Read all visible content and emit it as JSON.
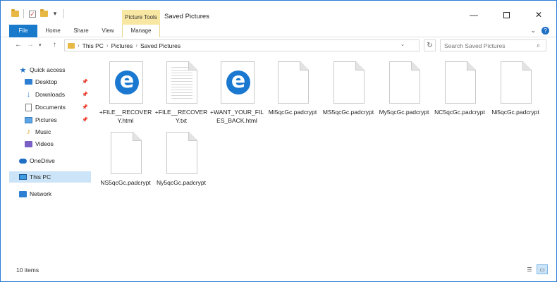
{
  "window": {
    "title": "Saved Pictures",
    "context_tab_header": "Picture Tools"
  },
  "ribbon": {
    "tabs": [
      {
        "label": "File"
      },
      {
        "label": "Home"
      },
      {
        "label": "Share"
      },
      {
        "label": "View"
      },
      {
        "label": "Manage"
      }
    ]
  },
  "address": {
    "crumbs": [
      "This PC",
      "Pictures",
      "Saved Pictures"
    ],
    "search_placeholder": "Search Saved Pictures"
  },
  "sidebar": {
    "items": [
      {
        "label": "Quick access",
        "icon": "star-icon"
      },
      {
        "label": "Desktop",
        "icon": "desktop-icon",
        "pinned": true
      },
      {
        "label": "Downloads",
        "icon": "download-icon",
        "pinned": true
      },
      {
        "label": "Documents",
        "icon": "documents-icon",
        "pinned": true
      },
      {
        "label": "Pictures",
        "icon": "pictures-icon",
        "pinned": true
      },
      {
        "label": "Music",
        "icon": "music-icon"
      },
      {
        "label": "Videos",
        "icon": "videos-icon"
      },
      {
        "label": "OneDrive",
        "icon": "onedrive-icon"
      },
      {
        "label": "This PC",
        "icon": "this-pc-icon",
        "selected": true
      },
      {
        "label": "Network",
        "icon": "network-icon"
      }
    ]
  },
  "files": [
    {
      "label": "+FILE__RECOVERY.html",
      "type": "html"
    },
    {
      "label": "+FILE__RECOVERY.txt",
      "type": "txt"
    },
    {
      "label": "+WANT_YOUR_FILES_BACK.html",
      "type": "html"
    },
    {
      "label": "Mi5qcGc.padcrypt",
      "type": "blank"
    },
    {
      "label": "MS5qcGc.padcrypt",
      "type": "blank"
    },
    {
      "label": "My5qcGc.padcrypt",
      "type": "blank"
    },
    {
      "label": "NC5qcGc.padcrypt",
      "type": "blank"
    },
    {
      "label": "Ni5qcGc.padcrypt",
      "type": "blank"
    },
    {
      "label": "NS5qcGc.padcrypt",
      "type": "blank"
    },
    {
      "label": "Ny5qcGc.padcrypt",
      "type": "blank"
    }
  ],
  "status": {
    "item_count": "10 items"
  }
}
